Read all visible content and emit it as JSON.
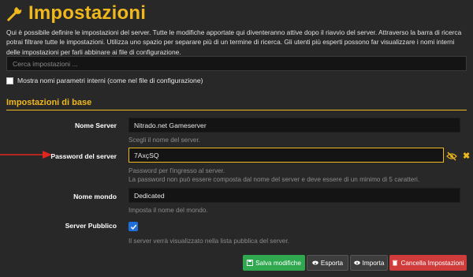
{
  "header": {
    "title": "Impostazioni",
    "intro": "Qui è possibile definire le impostazioni del server. Tutte le modifiche apportate qui diventeranno attive dopo il riavvio del server. Attraverso la barra di ricerca potrai filtrare tutte le impostazioni. Utilizza uno spazio per separare più di un termine di ricerca. Gli utenti più esperti possono far visualizzare i nomi interni delle impostazioni per farli abbinare ai file di configurazione."
  },
  "search": {
    "placeholder": "Cerca impostazioni ..."
  },
  "show_internal_names": {
    "label": "Mostra nomi parametri interni (come nel file di configurazione)",
    "checked": false
  },
  "section": {
    "title": "Impostazioni di base"
  },
  "settings": {
    "server_name": {
      "label": "Nome Server",
      "value": "Nitrado.net Gameserver",
      "help": "Scegli il nome del server."
    },
    "password": {
      "label": "Password del server",
      "value": "7AxçSQ",
      "help1": "Password per l'ingresso al server.",
      "help2": "La password non può essere composta dal nome del server e deve essere di un minimo di 5 caratteri."
    },
    "world_name": {
      "label": "Nome mondo",
      "value": "Dedicated",
      "help": "Imposta il nome del mondo."
    },
    "public_server": {
      "label": "Server Pubblico",
      "checked": true,
      "help": "Il server verrà visualizzato nella lista pubblica del server."
    }
  },
  "buttons": {
    "save": "Salva modifiche",
    "export": "Esporta",
    "import": "Importa",
    "delete": "Cancella Impostazioni"
  },
  "colors": {
    "accent": "#f0b81c",
    "save": "#2fa84f",
    "delete": "#d03b3b",
    "checkbox": "#1e6fdc",
    "arrow": "#e0261e"
  },
  "icons": [
    "wrench-icon",
    "eye-slash-icon",
    "close-icon",
    "floppy-icon",
    "cloud-download-icon",
    "cloud-upload-icon",
    "trash-icon",
    "check-icon"
  ]
}
